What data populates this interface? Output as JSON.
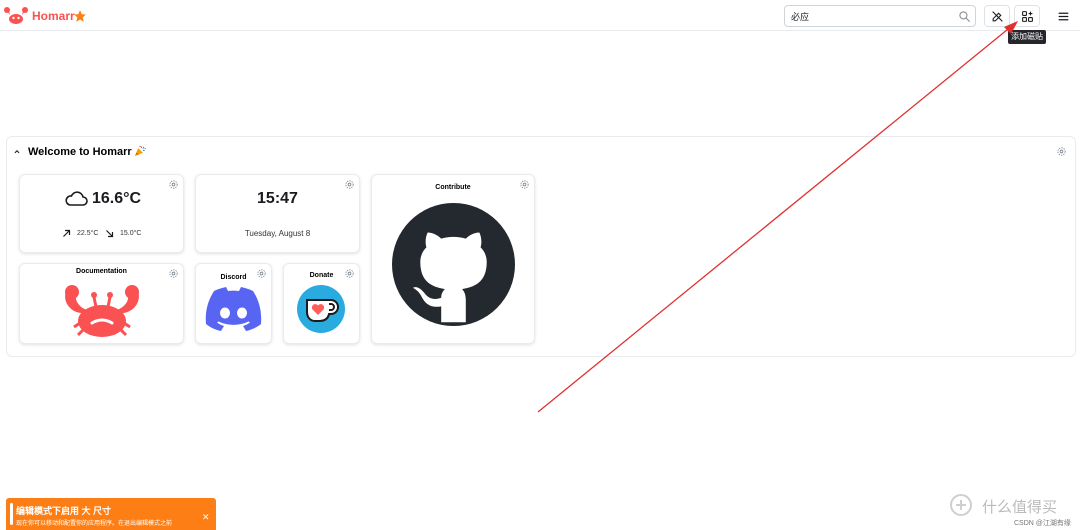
{
  "header": {
    "brand": "Homarr",
    "search": {
      "value": "必应",
      "placeholder": ""
    },
    "tooltip": "添加磁贴"
  },
  "category": {
    "title": "Welcome to Homarr"
  },
  "weather": {
    "temperature": "16.6°C",
    "high": "22.5°C",
    "low": "15.0°C"
  },
  "clock": {
    "time": "15:47",
    "date": "Tuesday, August 8"
  },
  "tiles": {
    "contribute": "Contribute",
    "documentation": "Documentation",
    "discord": "Discord",
    "donate": "Donate"
  },
  "toast": {
    "title": "编辑模式下启用 大 尺寸",
    "body": "现在你可以移动和配置你的应用程序。在退出编辑模式之前"
  },
  "watermark": {
    "site": "什么值得买",
    "credit": "CSDN @江湖有缘"
  },
  "colors": {
    "brand": "#fa5252",
    "star": "#fd7e14",
    "toast": "#fd7e14",
    "arrow": "#e03131",
    "discord": "#5865f2",
    "kofi": "#29abe0",
    "github": "#24292f"
  }
}
